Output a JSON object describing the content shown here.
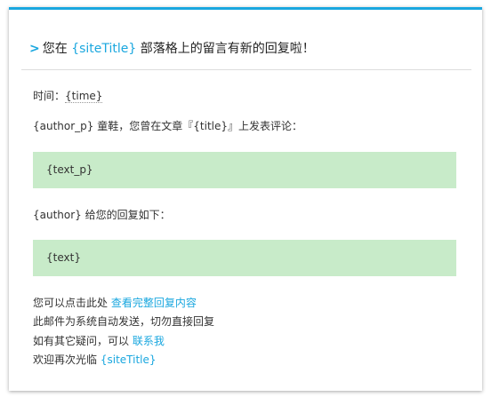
{
  "colors": {
    "accent": "#1aa7df",
    "quote_bg": "#c8ebc9",
    "text": "#333333"
  },
  "header": {
    "chevron": ">",
    "prefix": "您在",
    "site_title": "{siteTitle}",
    "suffix": "部落格上的留言有新的回复啦！"
  },
  "time": {
    "label": "时间：",
    "value": "{time}"
  },
  "intro": {
    "author": "{author_p}",
    "text": "童鞋，您曾在文章『{title}』上发表评论："
  },
  "original_comment": "{text_p}",
  "reply_intro": {
    "author": "{author}",
    "text": "给您的回复如下："
  },
  "reply_text": "{text}",
  "footer": {
    "view_prefix": "您可以点击此处",
    "view_link": "查看完整回复内容",
    "auto_notice": "此邮件为系统自动发送，切勿直接回复",
    "contact_prefix": "如有其它疑问，可以",
    "contact_link": "联系我",
    "welcome_prefix": "欢迎再次光临",
    "welcome_site": "{siteTitle}"
  }
}
